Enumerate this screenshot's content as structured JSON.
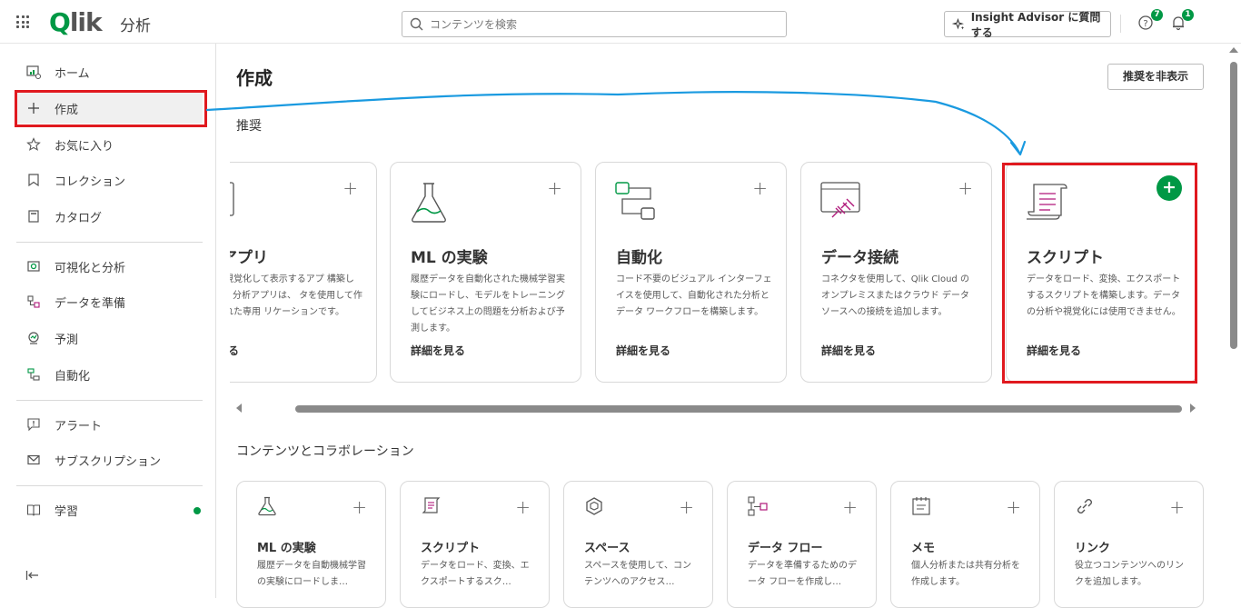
{
  "header": {
    "logo_text": "Qlik",
    "app_title": "分析",
    "search_placeholder": "コンテンツを検索",
    "insight_label": "Insight Advisor に質問する",
    "help_badge": "7",
    "notif_badge": "1"
  },
  "sidebar": {
    "items": [
      {
        "label": "ホーム",
        "icon": "home-icon"
      },
      {
        "label": "作成",
        "icon": "plus-icon"
      },
      {
        "label": "お気に入り",
        "icon": "star-icon"
      },
      {
        "label": "コレクション",
        "icon": "bookmark-icon"
      },
      {
        "label": "カタログ",
        "icon": "catalog-icon"
      },
      {
        "label": "可視化と分析",
        "icon": "analytics-icon"
      },
      {
        "label": "データを準備",
        "icon": "data-prep-icon"
      },
      {
        "label": "予測",
        "icon": "predict-icon"
      },
      {
        "label": "自動化",
        "icon": "automation-icon"
      },
      {
        "label": "アラート",
        "icon": "alert-icon"
      },
      {
        "label": "サブスクリプション",
        "icon": "mail-icon"
      },
      {
        "label": "学習",
        "icon": "book-icon"
      }
    ]
  },
  "main": {
    "title": "作成",
    "hide_button": "推奨を非表示",
    "recommended_title": "推奨",
    "recommended": [
      {
        "title": "析アプリ",
        "desc": "タを視覚化して表示するアプ 構築します。分析アプリは、 タを使用して作成された専用 リケーションです。",
        "link": "を見る"
      },
      {
        "title": "ML の実験",
        "desc": "履歴データを自動化された機械学習実験にロードし、モデルをトレーニングしてビジネス上の問題を分析および予測します。",
        "link": "詳細を見る"
      },
      {
        "title": "自動化",
        "desc": "コード不要のビジュアル インターフェイスを使用して、自動化された分析とデータ ワークフローを構築します。",
        "link": "詳細を見る"
      },
      {
        "title": "データ接続",
        "desc": "コネクタを使用して、Qlik Cloud のオンプレミスまたはクラウド データ ソースへの接続を追加します。",
        "link": "詳細を見る"
      },
      {
        "title": "スクリプト",
        "desc": "データをロード、変換、エクスポートするスクリプトを構築します。データの分析や視覚化には使用できません。",
        "link": "詳細を見る"
      }
    ],
    "content_title": "コンテンツとコラボレーション",
    "content": [
      {
        "title": "ML の実験",
        "desc": "履歴データを自動機械学習の実験にロードしま…"
      },
      {
        "title": "スクリプト",
        "desc": "データをロード、変換、エクスポートするスク…"
      },
      {
        "title": "スペース",
        "desc": "スペースを使用して、コンテンツへのアクセス…"
      },
      {
        "title": "データ フロー",
        "desc": "データを準備するためのデータ フローを作成し…"
      },
      {
        "title": "メモ",
        "desc": "個人分析または共有分析を作成します。"
      },
      {
        "title": "リンク",
        "desc": "役立つコンテンツへのリンクを追加します。"
      }
    ]
  },
  "colors": {
    "accent_green": "#009845",
    "highlight_red": "#e0191f",
    "annotation_blue": "#1a9ae0"
  }
}
